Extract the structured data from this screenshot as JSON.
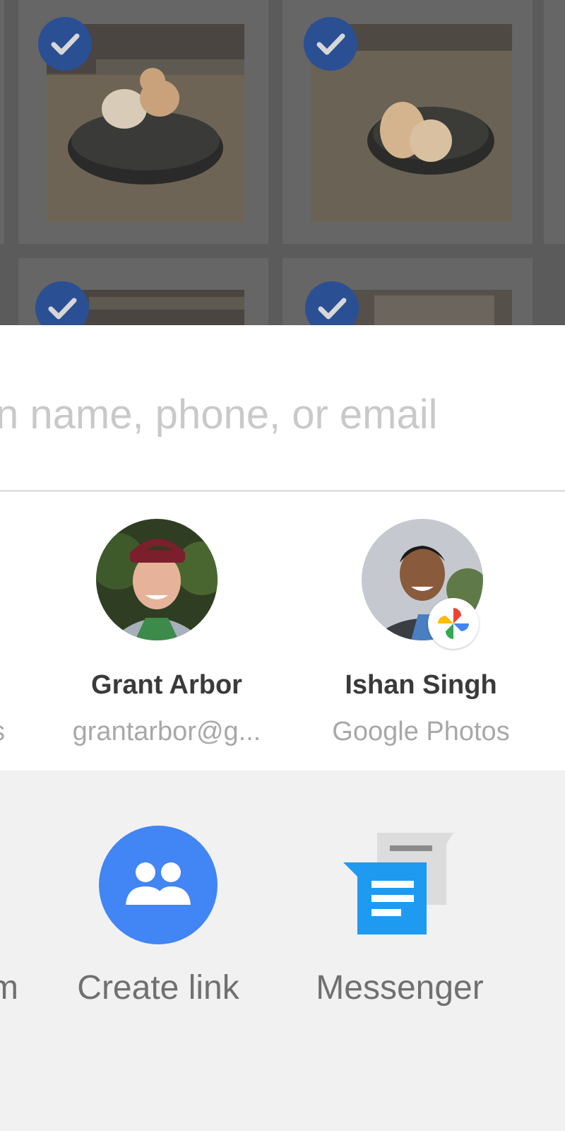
{
  "search": {
    "placeholder": "n name, phone, or email"
  },
  "photos": [
    {
      "name": "photo-1",
      "selected": true
    },
    {
      "name": "photo-2",
      "selected": true
    },
    {
      "name": "photo-3",
      "selected": true
    },
    {
      "name": "photo-4",
      "selected": true
    }
  ],
  "contacts": {
    "partial_sub": "s",
    "items": [
      {
        "name": "Grant Arbor",
        "sub": "grantarbor@g..."
      },
      {
        "name": "Ishan Singh",
        "sub": "Google Photos"
      }
    ]
  },
  "apps": {
    "partial_label": "m",
    "items": [
      {
        "label": "Create link",
        "icon": "people-icon"
      },
      {
        "label": "Messenger",
        "icon": "messenger-icon"
      }
    ]
  },
  "colors": {
    "check_blue": "#2b4f93",
    "create_link_blue": "#4285f4",
    "messenger_blue": "#1e9bf0"
  }
}
